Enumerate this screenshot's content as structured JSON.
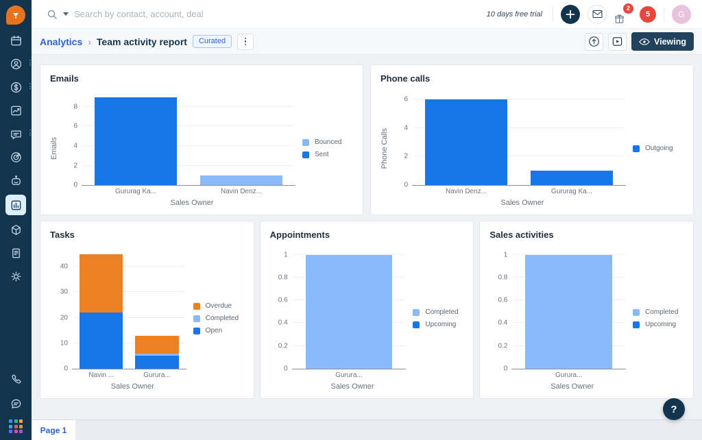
{
  "topbar": {
    "search_placeholder": "Search by contact, account, deal",
    "trial_text": "10 days free trial",
    "gift_badge_count": "2",
    "notification_count": "5",
    "avatar_initial": "G"
  },
  "toolbar": {
    "breadcrumb_parent": "Analytics",
    "breadcrumb_separator": "›",
    "breadcrumb_current": "Team activity report",
    "curated_badge": "Curated",
    "viewing_label": "Viewing"
  },
  "sidebar": {
    "icons": [
      "calendar",
      "contacts",
      "deals",
      "reports",
      "conversations",
      "goals",
      "bot",
      "analytics",
      "products",
      "documents",
      "settings"
    ],
    "active_icon": "analytics",
    "bottom_icons": [
      "phone",
      "chat",
      "apps-grid"
    ]
  },
  "footer": {
    "page_tab": "Page 1",
    "help_label": "?"
  },
  "colors": {
    "accent_blue": "#2e63cc",
    "bar_blue": "#1776e8",
    "bar_light_blue": "#8abaf9",
    "bar_orange": "#ec8123",
    "sidebar_navy": "#12344d",
    "badge_red": "#e8463c",
    "avatar_pink": "#e9c2dc"
  },
  "chart_data": [
    {
      "id": "emails",
      "type": "bar",
      "title": "Emails",
      "xlabel": "Sales Owner",
      "ylabel": "Emails",
      "categories": [
        "Gururag Ka...",
        "Navin Denz..."
      ],
      "series": [
        {
          "name": "Bounced",
          "color": "#8abaf9",
          "values": [
            0,
            1
          ]
        },
        {
          "name": "Sent",
          "color": "#1776e8",
          "values": [
            9,
            0
          ]
        }
      ],
      "legend": [
        "Bounced",
        "Sent"
      ],
      "yticks": [
        0,
        2,
        4,
        6,
        8
      ],
      "ymax": 9.4,
      "grid": true,
      "legend_position": "right"
    },
    {
      "id": "phone_calls",
      "type": "bar",
      "title": "Phone calls",
      "xlabel": "Sales Owner",
      "ylabel": "Phone Calls",
      "categories": [
        "Navin Denz...",
        "Gururag Ka..."
      ],
      "series": [
        {
          "name": "Outgoing",
          "color": "#1776e8",
          "values": [
            6,
            1
          ]
        }
      ],
      "legend": [
        "Outgoing"
      ],
      "yticks": [
        0,
        2,
        4,
        6
      ],
      "ymax": 6.45,
      "grid": true,
      "legend_position": "right"
    },
    {
      "id": "tasks",
      "type": "bar",
      "title": "Tasks",
      "xlabel": "Sales Owner",
      "ylabel": "",
      "categories": [
        "Navin ...",
        "Gurura..."
      ],
      "series": [
        {
          "name": "Open",
          "color": "#1776e8",
          "values": [
            22,
            5
          ]
        },
        {
          "name": "Completed",
          "color": "#8abaf9",
          "values": [
            0,
            1
          ]
        },
        {
          "name": "Overdue",
          "color": "#ec8123",
          "values": [
            23,
            7
          ]
        }
      ],
      "legend": [
        "Overdue",
        "Completed",
        "Open"
      ],
      "yticks": [
        0,
        10,
        20,
        30,
        40
      ],
      "ymax": 46.8,
      "grid": true,
      "legend_position": "right"
    },
    {
      "id": "appointments",
      "type": "bar",
      "title": "Appointments",
      "xlabel": "Sales Owner",
      "ylabel": "",
      "categories": [
        "Gurura..."
      ],
      "series": [
        {
          "name": "Completed",
          "color": "#8abaf9",
          "values": [
            1
          ]
        },
        {
          "name": "Upcoming",
          "color": "#1776e8",
          "values": [
            0
          ]
        }
      ],
      "legend": [
        "Completed",
        "Upcoming"
      ],
      "yticks": [
        0,
        0.2,
        0.4,
        0.6,
        0.8,
        1
      ],
      "ymax": 1.045,
      "grid": true,
      "legend_position": "right"
    },
    {
      "id": "sales_activities",
      "type": "bar",
      "title": "Sales activities",
      "xlabel": "Sales Owner",
      "ylabel": "",
      "categories": [
        "Gurura..."
      ],
      "series": [
        {
          "name": "Completed",
          "color": "#8abaf9",
          "values": [
            1
          ]
        },
        {
          "name": "Upcoming",
          "color": "#1776e8",
          "values": [
            0
          ]
        }
      ],
      "legend": [
        "Completed",
        "Upcoming"
      ],
      "yticks": [
        0,
        0.2,
        0.4,
        0.6,
        0.8,
        1
      ],
      "ymax": 1.045,
      "grid": true,
      "legend_position": "right"
    }
  ]
}
